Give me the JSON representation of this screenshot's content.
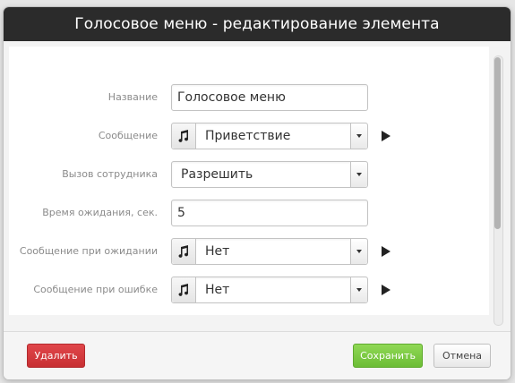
{
  "dialog": {
    "title": "Голосовое меню - редактирование элемента"
  },
  "form": {
    "name": {
      "label": "Название",
      "value": "Голосовое меню"
    },
    "message": {
      "label": "Сообщение",
      "value": "Приветствие"
    },
    "call_employee": {
      "label": "Вызов сотрудника",
      "value": "Разрешить"
    },
    "wait_time": {
      "label": "Время ожидания, сек.",
      "value": "5"
    },
    "wait_message": {
      "label": "Сообщение при ожидании",
      "value": "Нет"
    },
    "error_message": {
      "label": "Сообщение при ошибке",
      "value": "Нет"
    }
  },
  "footer": {
    "delete_label": "Удалить",
    "save_label": "Сохранить",
    "cancel_label": "Отмена"
  },
  "icons": {
    "music": "music-note-icon",
    "play": "play-icon",
    "dropdown": "chevron-down-icon"
  },
  "colors": {
    "titlebar": "#2b2b2b",
    "delete": "#d33b3e",
    "save": "#7cc944",
    "label": "#8b8b8b"
  }
}
